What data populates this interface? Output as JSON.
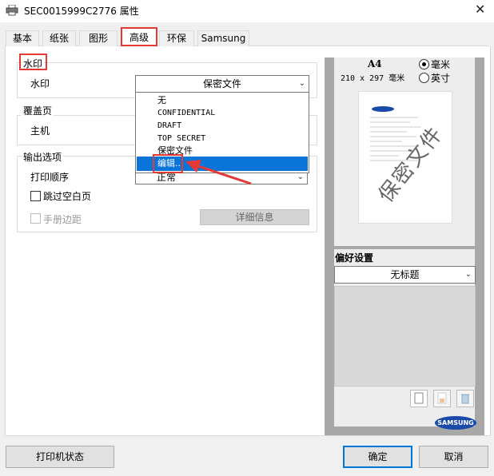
{
  "window": {
    "title": "SEC0015999C2776 属性",
    "close": "✕"
  },
  "tabs": [
    "基本",
    "纸张",
    "图形",
    "高级",
    "环保",
    "Samsung"
  ],
  "watermark_group": {
    "legend": "水印",
    "label": "水印",
    "selected": "保密文件",
    "options": [
      "无",
      "CONFIDENTIAL",
      "DRAFT",
      "TOP SECRET",
      "保密文件",
      "编辑..."
    ],
    "highlighted": "编辑..."
  },
  "overlay_group": {
    "legend": "覆盖页",
    "label": "主机"
  },
  "output_group": {
    "legend": "输出选项",
    "print_order_label": "打印顺序",
    "print_order_value": "正常",
    "skip_blank_label": "跳过空白页",
    "booklet_margin_label": "手册边距",
    "details_button": "详细信息"
  },
  "preview": {
    "paper_size": "A4",
    "dimensions": "210 x 297 毫米",
    "unit_mm": "毫米",
    "unit_inch": "英寸",
    "selected_unit": "毫米",
    "watermark_text": "保密文件",
    "brand": "SAMSUNG"
  },
  "favorites": {
    "label": "偏好设置",
    "selected": "无标题"
  },
  "footer": {
    "printer_status": "打印机状态",
    "ok": "确定",
    "cancel": "取消"
  },
  "colors": {
    "highlight_blue": "#0a75d8",
    "annotation_red": "#e53935",
    "preview_gray": "#a8a8a8"
  }
}
